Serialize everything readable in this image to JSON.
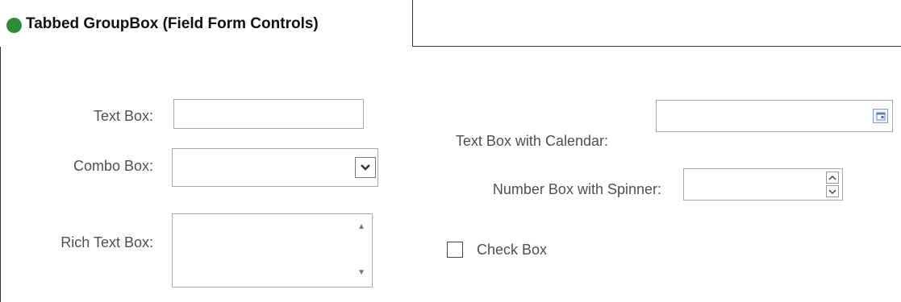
{
  "tab": {
    "title": "Tabbed GroupBox (Field Form Controls)",
    "status_color": "#2e8b3a"
  },
  "fields": {
    "text_box_label": "Text Box:",
    "text_box_value": "",
    "combo_box_label": "Combo Box:",
    "combo_box_value": "",
    "rich_text_box_label": "Rich Text Box:",
    "rich_text_box_value": "",
    "calendar_label": "Text Box with Calendar:",
    "calendar_value": "",
    "spinner_label": "Number Box with Spinner:",
    "spinner_value": "",
    "checkbox_label": "Check Box",
    "checkbox_checked": false
  },
  "icons": {
    "combo": "chevron-down-icon",
    "calendar": "calendar-icon",
    "spin_up": "spin-up-icon",
    "spin_down": "spin-down-icon",
    "scroll_up": "scroll-up-icon",
    "scroll_down": "scroll-down-icon"
  }
}
